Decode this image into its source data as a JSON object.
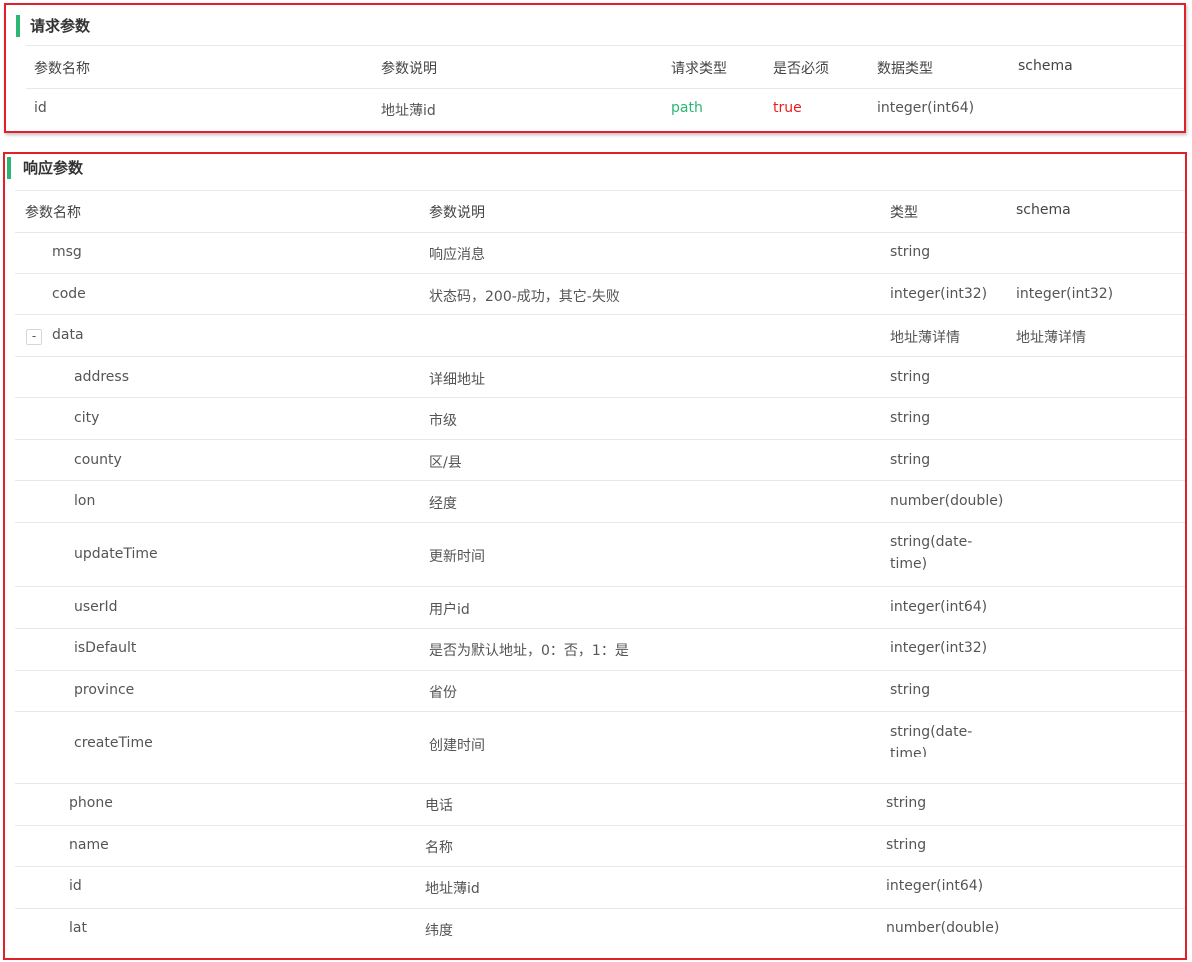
{
  "request": {
    "title": "请求参数",
    "headers": {
      "name": "参数名称",
      "desc": "参数说明",
      "req_type": "请求类型",
      "required": "是否必须",
      "data_type": "数据类型",
      "schema": "schema"
    },
    "row": {
      "name": "id",
      "desc": "地址薄id",
      "req_type": "path",
      "required": "true",
      "data_type": "integer(int64)",
      "schema": ""
    }
  },
  "response": {
    "title": "响应参数",
    "headers": {
      "name": "参数名称",
      "desc": "参数说明",
      "type": "类型",
      "schema": "schema"
    },
    "rows": [
      {
        "name": "msg",
        "desc": "响应消息",
        "type": "string",
        "schema": ""
      },
      {
        "name": "code",
        "desc": "状态码，200-成功，其它-失败",
        "type": "integer(int32)",
        "schema": "integer(int32)"
      },
      {
        "name": "data",
        "desc": "",
        "type": "地址薄详情",
        "schema": "地址薄详情",
        "toggle": "-"
      },
      {
        "name": "address",
        "desc": "详细地址",
        "type": "string",
        "schema": ""
      },
      {
        "name": "city",
        "desc": "市级",
        "type": "string",
        "schema": ""
      },
      {
        "name": "county",
        "desc": "区/县",
        "type": "string",
        "schema": ""
      },
      {
        "name": "lon",
        "desc": "经度",
        "type": "number(double)",
        "schema": ""
      },
      {
        "name": "updateTime",
        "desc": "更新时间",
        "type": "string(date-time)",
        "schema": ""
      },
      {
        "name": "userId",
        "desc": "用户id",
        "type": "integer(int64)",
        "schema": ""
      },
      {
        "name": "isDefault",
        "desc": "是否为默认地址，0：否，1：是",
        "type": "integer(int32)",
        "schema": ""
      },
      {
        "name": "province",
        "desc": "省份",
        "type": "string",
        "schema": ""
      },
      {
        "name": "createTime",
        "desc": "创建时间",
        "type": "string(date-time)",
        "schema": ""
      },
      {
        "name": "phone",
        "desc": "电话",
        "type": "string",
        "schema": ""
      },
      {
        "name": "name",
        "desc": "名称",
        "type": "string",
        "schema": ""
      },
      {
        "name": "id",
        "desc": "地址薄id",
        "type": "integer(int64)",
        "schema": ""
      },
      {
        "name": "lat",
        "desc": "纬度",
        "type": "number(double)",
        "schema": ""
      }
    ]
  }
}
